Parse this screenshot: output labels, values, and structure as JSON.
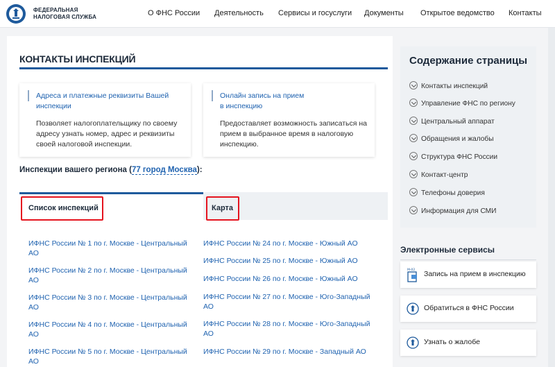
{
  "header": {
    "org_line1": "ФЕДЕРАЛЬНАЯ",
    "org_line2": "НАЛОГОВАЯ СЛУЖБА",
    "nav": [
      "О ФНС России",
      "Деятельность",
      "Сервисы и госуслуги",
      "Документы",
      "Открытое ведомство",
      "Контакты"
    ]
  },
  "page_title": "КОНТАКТЫ ИНСПЕКЦИЙ",
  "cards": [
    {
      "link_line1": "Адреса и платежные реквизиты Вашей",
      "link_line2": "инспекции",
      "text_line1": "Позволяет налогоплательщику по своему",
      "text_line2": "адресу узнать номер, адрес и реквизиты",
      "text_line3": "своей налоговой инспекции."
    },
    {
      "link_line1": "Онлайн запись на прием",
      "link_line2": "в инспекцию",
      "text_line1": "Предоставляет возможность записаться на",
      "text_line2": "прием в выбранное время в налоговую",
      "text_line3": "инспекцию."
    }
  ],
  "region": {
    "label": "Инспекции вашего региона (",
    "link": "77 город Москва",
    "suffix": "):"
  },
  "tabs": [
    "Список инспекций",
    "Карта"
  ],
  "inspections_left": [
    {
      "line1": "ИФНС России № 1 по г. Москве - Центральный",
      "line2": "АО"
    },
    {
      "line1": "ИФНС России № 2 по г. Москве - Центральный",
      "line2": "АО"
    },
    {
      "line1": "ИФНС России № 3 по г. Москве - Центральный",
      "line2": "АО"
    },
    {
      "line1": "ИФНС России № 4 по г. Москве - Центральный",
      "line2": "АО"
    },
    {
      "line1": "ИФНС России № 5 по г. Москве - Центральный",
      "line2": "АО"
    }
  ],
  "inspections_right": [
    "ИФНС России № 24 по г. Москве - Южный АО",
    "ИФНС России № 25 по г. Москве - Южный АО",
    "ИФНС России № 26 по г. Москве - Южный АО",
    "ИФНС России № 27 по г. Москве - Юго-Западный",
    "АО",
    "ИФНС России № 28 по г. Москве - Юго-Западный",
    "АО",
    "ИФНС России № 29 по г. Москве - Западный АО"
  ],
  "sidebar": {
    "title": "Содержание страницы",
    "items": [
      "Контакты инспекций",
      "Управление ФНС по региону",
      "Центральный аппарат",
      "Обращения и жалобы",
      "Структура ФНС России",
      "Контакт-центр",
      "Телефоны доверия",
      "Информация для СМИ"
    ]
  },
  "eservices": {
    "title": "Электронные сервисы",
    "items": [
      "Запись на прием в инспекцию",
      "Обратиться в ФНС России",
      "Узнать о жалобе"
    ],
    "icon_badge": "М-02"
  },
  "colors": {
    "accent": "#1e5a9c",
    "link": "#2063b0",
    "highlight": "#e5141f"
  }
}
